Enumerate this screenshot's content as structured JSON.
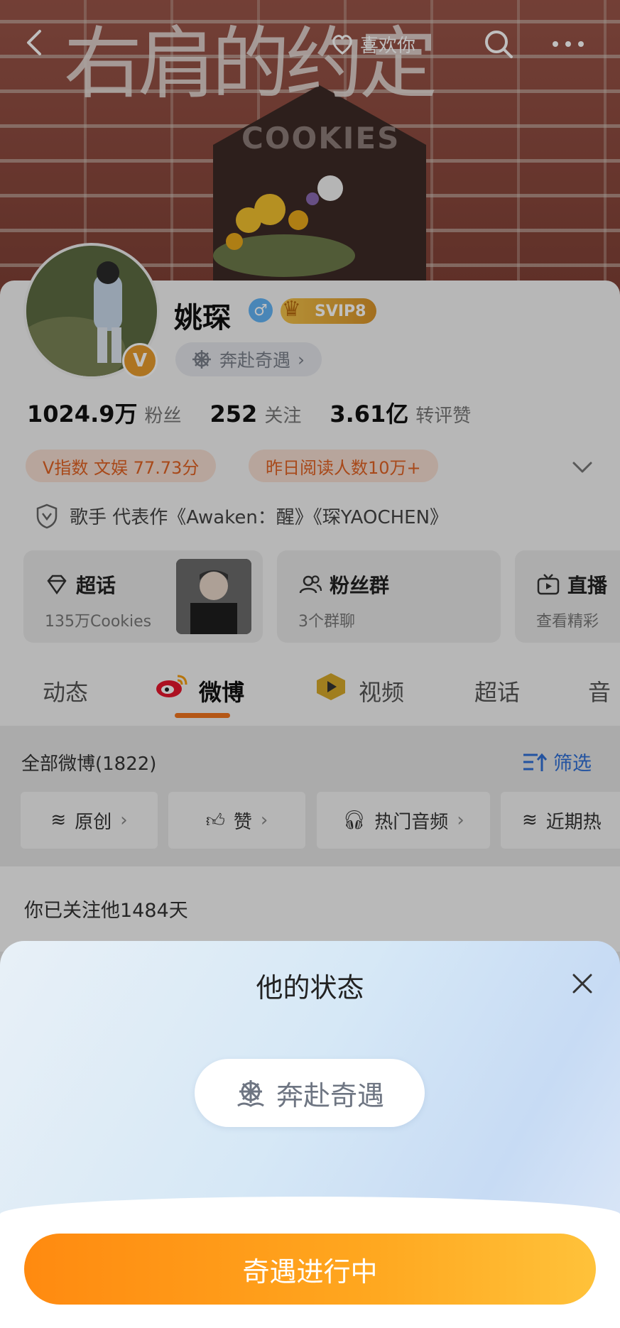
{
  "cover": {
    "title_art": "右肩的约定",
    "sign_text": "COOKIES",
    "like_label": "喜欢你"
  },
  "profile": {
    "name": "姚琛",
    "gender_symbol": "♂",
    "vip_label": "SVIP8",
    "avatar_badge": "V",
    "status_label": "奔赴奇遇",
    "stats": [
      {
        "num": "1024.9万",
        "label": "粉丝"
      },
      {
        "num": "252",
        "label": "关注"
      },
      {
        "num": "3.61亿",
        "label": "转评赞"
      }
    ],
    "tag_vindex": "V指数 文娱 77.73分",
    "tag_reads": "昨日阅读人数10万+",
    "bio": "歌手 代表作《Awaken：醒》《琛YAOCHEN》"
  },
  "cards": [
    {
      "title": "超话",
      "sub": "135万Cookies",
      "icon": "diamond-icon"
    },
    {
      "title": "粉丝群",
      "sub": "3个群聊",
      "icon": "people-icon"
    },
    {
      "title": "直播",
      "sub": "查看精彩",
      "icon": "tv-icon"
    }
  ],
  "tabs": [
    "动态",
    "微博",
    "视频",
    "超话",
    "音"
  ],
  "feed": {
    "all_label": "全部微博(1822)",
    "filter_label": "筛选",
    "chips": [
      "原创",
      "赞",
      "热门音频",
      "近期热"
    ],
    "follow_text": "你已关注他1484天"
  },
  "sheet": {
    "title": "他的状态",
    "status": "奔赴奇遇",
    "cta": "奇遇进行中"
  },
  "colors": {
    "accent": "#f1741e",
    "cta_start": "#ff8a10",
    "cta_end": "#ffc23a",
    "link": "#2f6fd6"
  }
}
